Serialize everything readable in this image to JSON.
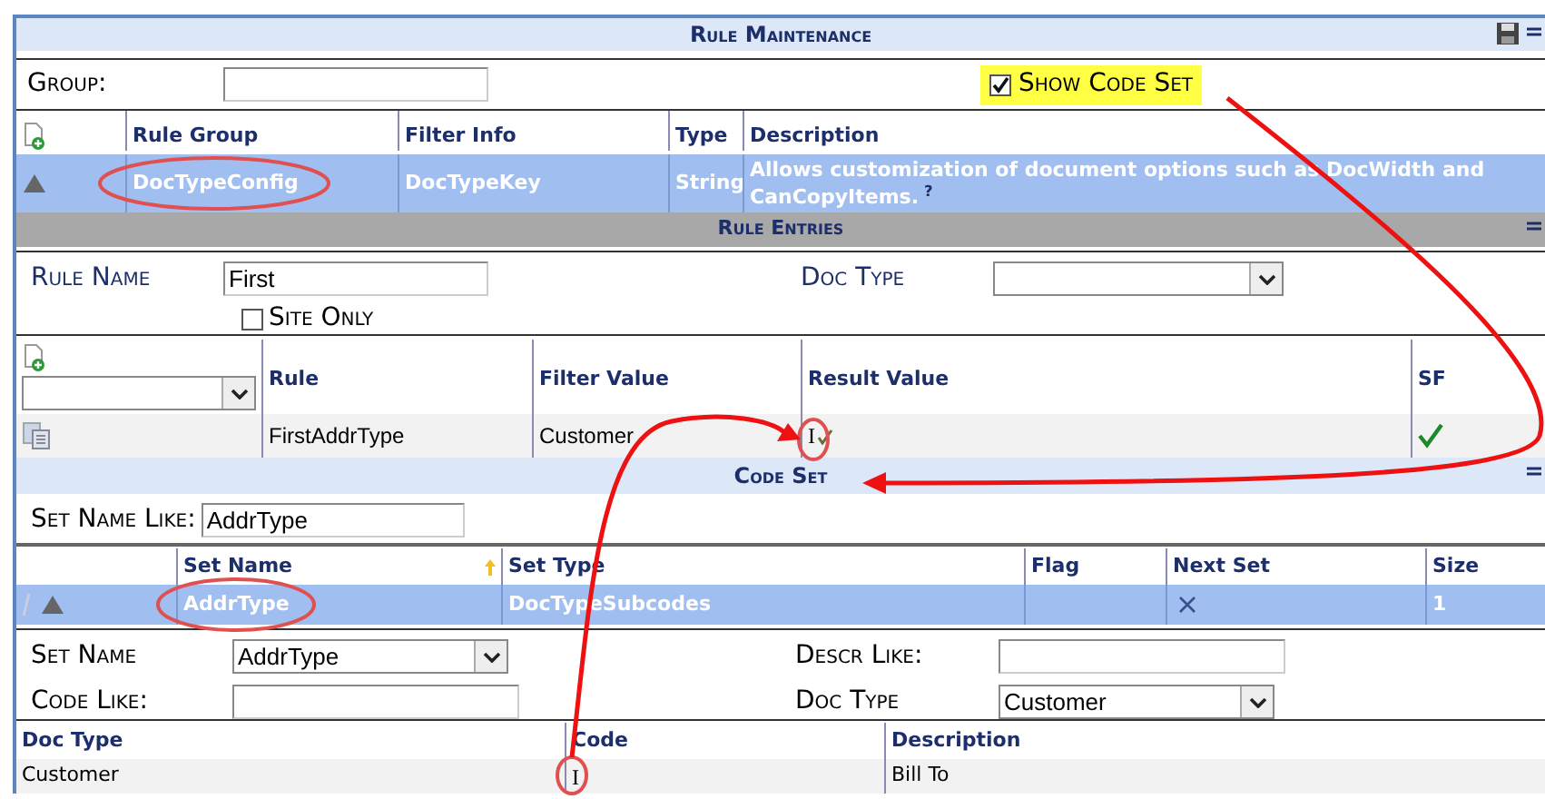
{
  "title": "Rule Maintenance",
  "group": {
    "label": "Group:"
  },
  "show_code_set": {
    "label": "Show Code Set",
    "checked": true
  },
  "rule_groups": {
    "columns": [
      "Rule Group",
      "Filter Info",
      "Type",
      "Description"
    ],
    "rows": [
      {
        "selected": true,
        "rule_group": "DocTypeConfig",
        "filter_info": "DocTypeKey",
        "type": "String",
        "description": "Allows customization of document options such as DocWidth and CanCopyItems.",
        "help": "?"
      }
    ]
  },
  "rule_entries": {
    "title": "Rule Entries",
    "rule_name": {
      "label": "Rule Name",
      "value": "First"
    },
    "doc_type": {
      "label": "Doc Type"
    },
    "site_only": {
      "label": "Site Only",
      "checked": false
    },
    "columns": [
      "Rule",
      "Filter Value",
      "Result Value",
      "SF"
    ],
    "rows": [
      {
        "rule": "FirstAddrType",
        "filter_value": "Customer",
        "result_value": "I",
        "sf": true
      }
    ]
  },
  "code_set": {
    "title": "Code Set",
    "set_name_like": {
      "label": "Set Name Like:",
      "value": "AddrType"
    },
    "columns": [
      "Set Name",
      "Set Type",
      "Flag",
      "Next Set",
      "Size"
    ],
    "rows": [
      {
        "selected": true,
        "set_name": "AddrType",
        "set_type": "DocTypeSubcodes",
        "size": "1"
      }
    ],
    "filters": {
      "set_name": {
        "label": "Set Name",
        "value": "AddrType"
      },
      "descr_like": {
        "label": "Descr Like:"
      },
      "code_like": {
        "label": "Code Like:"
      },
      "doc_type": {
        "label": "Doc Type",
        "value": "Customer"
      }
    },
    "code_columns": [
      "Doc Type",
      "Code",
      "Description"
    ],
    "codes": [
      {
        "doc_type": "Customer",
        "code": "I",
        "description": "Bill To"
      }
    ]
  }
}
